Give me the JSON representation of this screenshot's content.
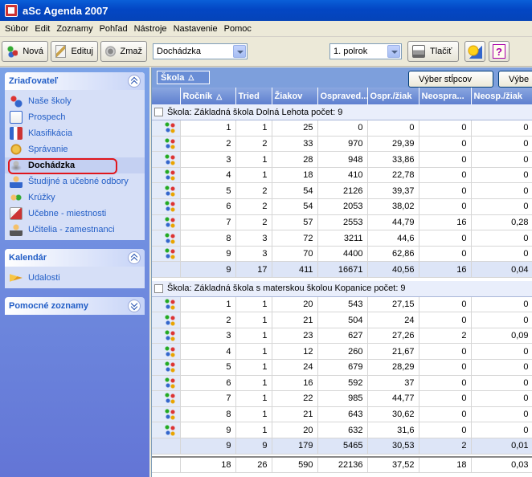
{
  "window": {
    "title": "aSc Agenda 2007"
  },
  "menu": [
    "Súbor",
    "Edit",
    "Zoznamy",
    "Pohľad",
    "Nástroje",
    "Nastavenie",
    "Pomoc"
  ],
  "toolbar": {
    "new_label": "Nová",
    "edit_label": "Edituj",
    "delete_label": "Zmaž",
    "view_select": "Dochádzka",
    "period_select": "1. polrok",
    "print_label": "Tlačiť"
  },
  "sidebar": {
    "founder": {
      "title": "Zriaďovateľ",
      "items": [
        {
          "label": "Naše školy",
          "icon": "school-icon"
        },
        {
          "label": "Prospech",
          "icon": "grades-icon"
        },
        {
          "label": "Klasifikácia",
          "icon": "classification-icon"
        },
        {
          "label": "Správanie",
          "icon": "behavior-icon"
        },
        {
          "label": "Dochádzka",
          "icon": "attendance-icon"
        },
        {
          "label": "Študijné a učebné odbory",
          "icon": "study-fields-icon"
        },
        {
          "label": "Krúžky",
          "icon": "clubs-icon"
        },
        {
          "label": "Učebne - miestnosti",
          "icon": "classrooms-icon"
        },
        {
          "label": "Učitelia - zamestnanci",
          "icon": "teachers-icon"
        }
      ]
    },
    "calendar": {
      "title": "Kalendár",
      "items": [
        {
          "label": "Udalosti",
          "icon": "events-icon"
        }
      ]
    },
    "lists": {
      "title": "Pomocné zoznamy"
    }
  },
  "grid": {
    "group_by_label": "Škola",
    "column_chooser_label": "Výber stĺpcov",
    "second_button_label": "Výbe",
    "columns": [
      "Ročník",
      "Tried",
      "Žiakov",
      "Ospraved...",
      "Ospr./žiak",
      "Neospra...",
      "Neosp./žiak"
    ],
    "groups": [
      {
        "title": "Škola:  Základná škola Dolná Lehota  počet: 9",
        "rows": [
          [
            "1",
            "1",
            "25",
            "0",
            "0",
            "0",
            "0"
          ],
          [
            "2",
            "2",
            "33",
            "970",
            "29,39",
            "0",
            "0"
          ],
          [
            "3",
            "1",
            "28",
            "948",
            "33,86",
            "0",
            "0"
          ],
          [
            "4",
            "1",
            "18",
            "410",
            "22,78",
            "0",
            "0"
          ],
          [
            "5",
            "2",
            "54",
            "2126",
            "39,37",
            "0",
            "0"
          ],
          [
            "6",
            "2",
            "54",
            "2053",
            "38,02",
            "0",
            "0"
          ],
          [
            "7",
            "2",
            "57",
            "2553",
            "44,79",
            "16",
            "0,28"
          ],
          [
            "8",
            "3",
            "72",
            "3211",
            "44,6",
            "0",
            "0"
          ],
          [
            "9",
            "3",
            "70",
            "4400",
            "62,86",
            "0",
            "0"
          ]
        ],
        "summary": [
          "9",
          "17",
          "411",
          "16671",
          "40,56",
          "16",
          "0,04"
        ]
      },
      {
        "title": "Škola:  Základná škola s materskou školou Kopanice  počet: 9",
        "rows": [
          [
            "1",
            "1",
            "20",
            "543",
            "27,15",
            "0",
            "0"
          ],
          [
            "2",
            "1",
            "21",
            "504",
            "24",
            "0",
            "0"
          ],
          [
            "3",
            "1",
            "23",
            "627",
            "27,26",
            "2",
            "0,09"
          ],
          [
            "4",
            "1",
            "12",
            "260",
            "21,67",
            "0",
            "0"
          ],
          [
            "5",
            "1",
            "24",
            "679",
            "28,29",
            "0",
            "0"
          ],
          [
            "6",
            "1",
            "16",
            "592",
            "37",
            "0",
            "0"
          ],
          [
            "7",
            "1",
            "22",
            "985",
            "44,77",
            "0",
            "0"
          ],
          [
            "8",
            "1",
            "21",
            "643",
            "30,62",
            "0",
            "0"
          ],
          [
            "9",
            "1",
            "20",
            "632",
            "31,6",
            "0",
            "0"
          ]
        ],
        "summary": [
          "9",
          "9",
          "179",
          "5465",
          "30,53",
          "2",
          "0,01"
        ]
      }
    ],
    "total": [
      "18",
      "26",
      "590",
      "22136",
      "37,52",
      "18",
      "0,03"
    ]
  }
}
